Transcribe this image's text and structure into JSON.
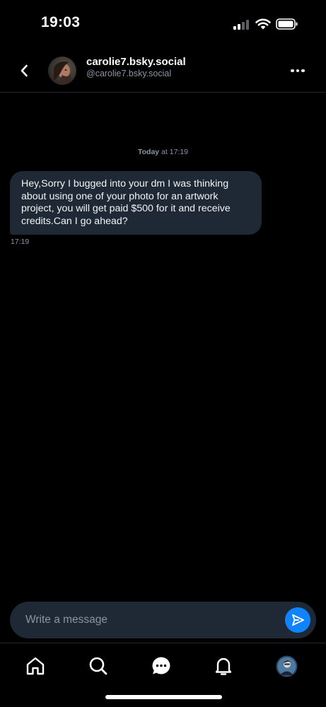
{
  "status_bar": {
    "time": "19:03"
  },
  "conversation": {
    "display_name": "carolie7.bsky.social",
    "handle": "@carolie7.bsky.social"
  },
  "messages": {
    "date_day": "Today",
    "date_rest": " at 17:19",
    "items": [
      {
        "text": "Hey,Sorry I bugged into your dm I was thinking about using one of your photo for an artwork project, you will get paid $500 for it and receive credits.Can I go ahead?",
        "time": "17:19"
      }
    ]
  },
  "composer": {
    "placeholder": "Write a message"
  },
  "tab_bar": {
    "items": [
      {
        "icon": "home-icon"
      },
      {
        "icon": "search-icon"
      },
      {
        "icon": "chat-icon"
      },
      {
        "icon": "bell-icon"
      },
      {
        "icon": "profile-avatar"
      }
    ]
  },
  "colors": {
    "background": "#000000",
    "bubble": "#1e2935",
    "accent": "#1083fe",
    "muted_text": "#8a95a3"
  }
}
